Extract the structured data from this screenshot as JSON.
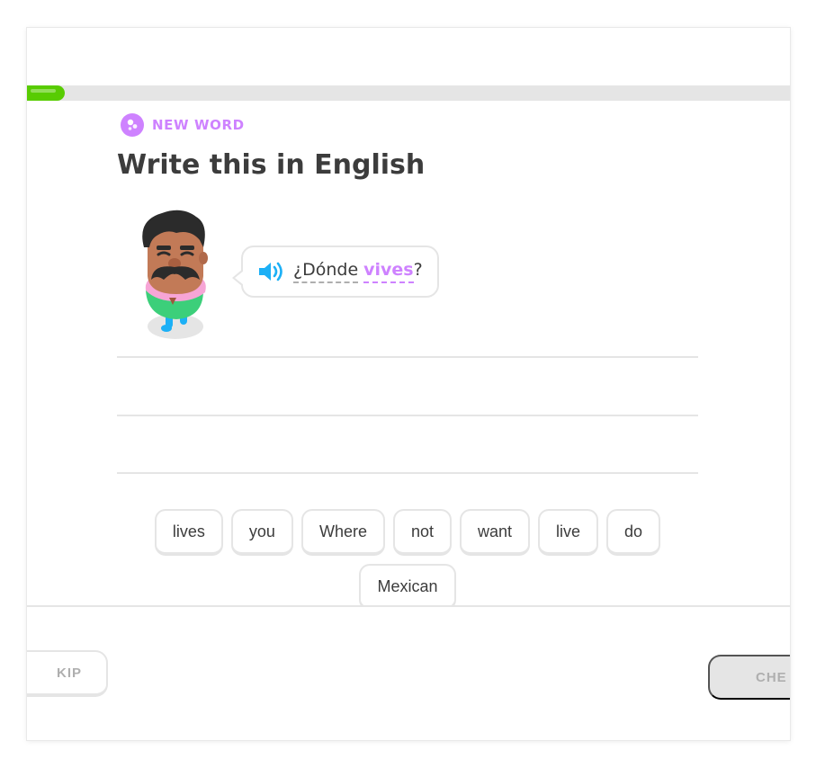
{
  "progress": {
    "fraction": 0.05,
    "color": "#58cc02"
  },
  "header": {
    "badge_label": "NEW WORD",
    "badge_icon": "new-word-icon",
    "accent": "#ce82ff"
  },
  "exercise": {
    "instruction": "Write this in English",
    "prompt": {
      "prefix": "¿Dónde",
      "new_word": "vives",
      "suffix": "?"
    },
    "speaker_icon": "speaker-icon",
    "speaker_color": "#1cb0f6"
  },
  "word_bank": [
    "lives",
    "you",
    "Where",
    "not",
    "want",
    "live",
    "do",
    "Mexican"
  ],
  "footer": {
    "skip_label": "KIP",
    "check_label": "CHE"
  }
}
